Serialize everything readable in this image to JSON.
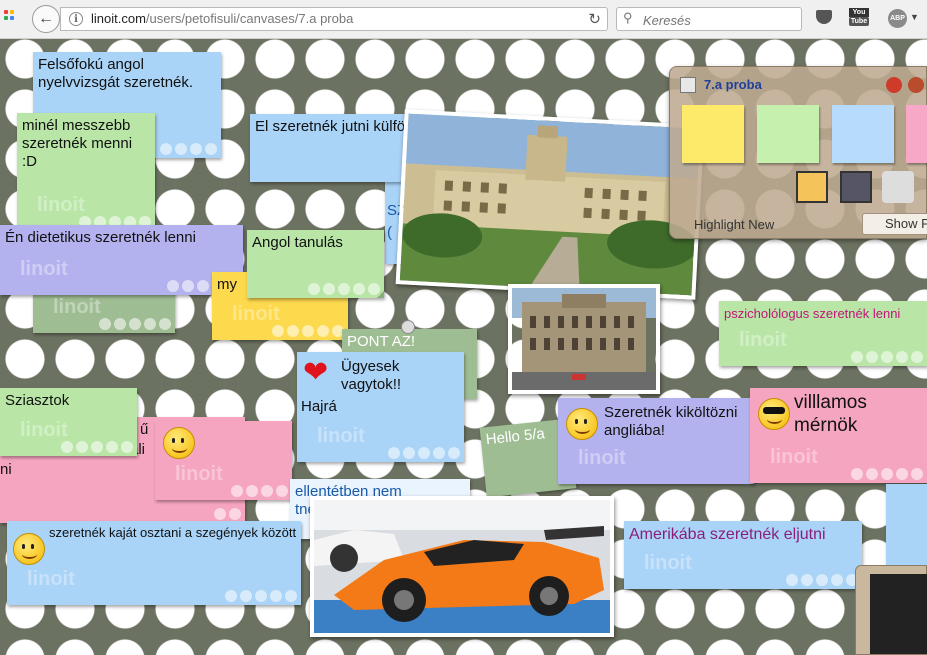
{
  "browser": {
    "url_host": "linoit.com",
    "url_path": "/users/petofisuli/canvases/7.a proba",
    "search_placeholder": "Keresés",
    "youtube_top": "You",
    "youtube_bottom": "Tube",
    "abp": "ABP"
  },
  "panel": {
    "title": "7.a proba",
    "highlight_new": "Highlight New",
    "show": "Show P"
  },
  "watermark": "linoit",
  "notes": {
    "n1": "Felsőfokú angol nyelvvizsgát szeretnék.",
    "n2": "minél messzebb szeretnék menni :D",
    "n3": "El szeretnék jutni külföldre.",
    "n4": "Én dietetikus szeretnék lenni",
    "n5": "Angol tanulás",
    "n6": "my",
    "n7": "PONT AZ!",
    "n8_a": "Ügyesek vagytok!!",
    "n8_b": "Hajrá",
    "n9": "pszicholólogus szeretnék lenni",
    "n10": "Sziasztok",
    "n11": "Szeretnék kiköltözni angliába!",
    "n12": "villlamos mérnök",
    "n13": "Hello 5/a",
    "n14": "ellentétben nem",
    "n15": "tnék se a",
    "n16": "szeretnék kaját osztani a szegények között",
    "n17": "Amerikába szeretnék eljutni",
    "n18_frag1": "ű",
    "n18_frag2": "ali",
    "n18_frag3": "ni",
    "n19_frag": "SZ",
    "n19_frag2": "("
  },
  "colors": {
    "canvas": "#6c7261",
    "panel_title": "#1f3f9a",
    "magenta_text": "#c0157a"
  }
}
